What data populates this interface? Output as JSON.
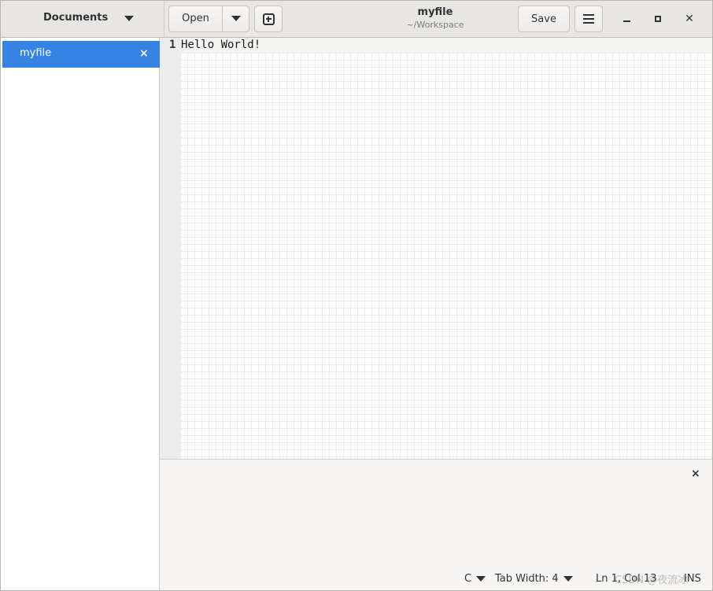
{
  "header": {
    "documents_label": "Documents",
    "open_label": "Open",
    "title": "myfile",
    "subtitle": "~/Workspace",
    "save_label": "Save"
  },
  "sidebar": {
    "items": [
      {
        "label": "myfile",
        "close": "×",
        "selected": true
      }
    ]
  },
  "editor": {
    "lines": [
      {
        "number": "1",
        "text": "Hello World!"
      }
    ]
  },
  "bottom_pane": {
    "close": "×"
  },
  "statusbar": {
    "language": "C",
    "tab_width": "Tab Width: 4",
    "position": "Ln 1, Col 13",
    "mode": "INS",
    "watermark": "CSDN @夜流冰"
  },
  "colors": {
    "accent": "#3584e4",
    "headerbar": "#e8e6e3",
    "gutter": "#ececec"
  },
  "icons": [
    "chevron-down-icon",
    "new-tab-icon",
    "hamburger-menu-icon",
    "minimize-icon",
    "maximize-icon",
    "close-icon"
  ]
}
